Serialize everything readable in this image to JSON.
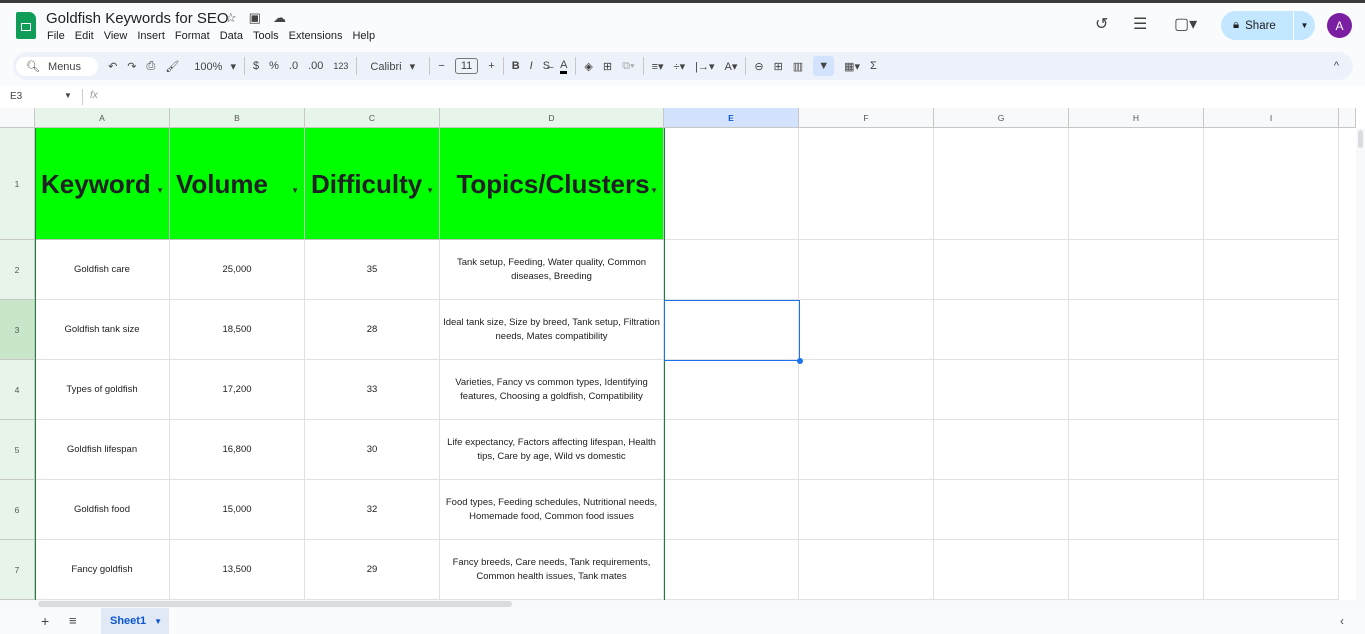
{
  "app": {
    "title": "Goldfish Keywords for SEO",
    "menu": [
      "File",
      "Edit",
      "View",
      "Insert",
      "Format",
      "Data",
      "Tools",
      "Extensions",
      "Help"
    ],
    "share_label": "Share",
    "avatar_initial": "A"
  },
  "toolbar": {
    "menus_label": "Menus",
    "zoom": "100%",
    "currency": "$",
    "percent": "%",
    "dec_less": ".0",
    "dec_more": ".00",
    "format_number": "123",
    "font": "Calibri",
    "font_size": "11",
    "bold": "B",
    "italic": "I",
    "text_color": "A"
  },
  "formula_bar": {
    "cell_ref": "E3",
    "fx": "fx",
    "value": ""
  },
  "sheet": {
    "columns": [
      "A",
      "B",
      "C",
      "D",
      "E",
      "F",
      "G",
      "H",
      "I"
    ],
    "selected_cell": "E3",
    "header_row": [
      "Keyword",
      "Volume",
      "Difficulty",
      "Topics/Clusters"
    ],
    "rows": [
      [
        "Goldfish care",
        "25,000",
        "35",
        "Tank setup, Feeding, Water quality, Common diseases, Breeding"
      ],
      [
        "Goldfish tank size",
        "18,500",
        "28",
        "Ideal tank size, Size by breed, Tank setup, Filtration needs, Mates compatibility"
      ],
      [
        "Types of goldfish",
        "17,200",
        "33",
        "Varieties, Fancy vs common types, Identifying features, Choosing a goldfish, Compatibility"
      ],
      [
        "Goldfish lifespan",
        "16,800",
        "30",
        "Life expectancy, Factors affecting lifespan, Health tips, Care by age, Wild vs domestic"
      ],
      [
        "Goldfish food",
        "15,000",
        "32",
        "Food types, Feeding schedules, Nutritional needs, Homemade food, Common food issues"
      ],
      [
        "Fancy goldfish",
        "13,500",
        "29",
        "Fancy breeds, Care needs, Tank requirements, Common health issues, Tank mates"
      ]
    ],
    "header_fill": "#00ff00"
  },
  "tabs": {
    "sheets": [
      "Sheet1"
    ]
  }
}
